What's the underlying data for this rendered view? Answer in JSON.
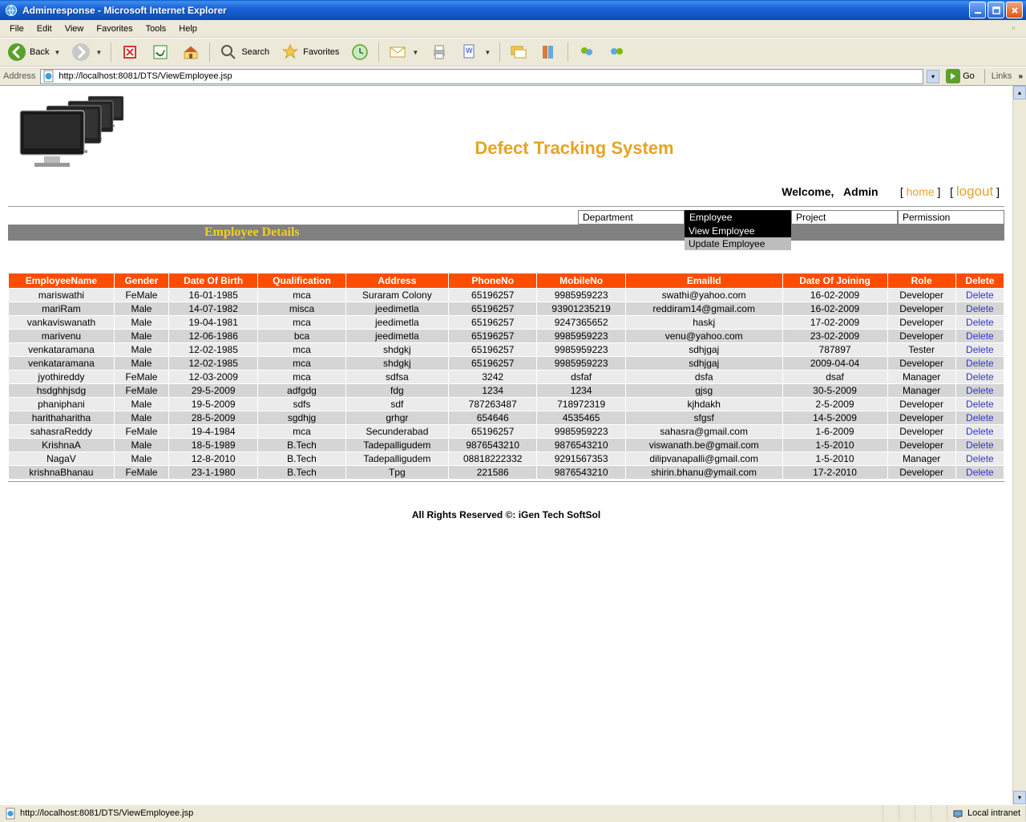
{
  "window": {
    "title": "Adminresponse - Microsoft Internet Explorer"
  },
  "menubar": [
    "File",
    "Edit",
    "View",
    "Favorites",
    "Tools",
    "Help"
  ],
  "toolbar": {
    "back": "Back",
    "search": "Search",
    "favorites": "Favorites"
  },
  "addressbar": {
    "label": "Address",
    "url": "http://localhost:8081/DTS/ViewEmployee.jsp",
    "go": "Go",
    "links": "Links"
  },
  "page": {
    "title": "Defect Tracking System",
    "welcome": "Welcome,",
    "user": "Admin",
    "home": "home",
    "logout": "logout",
    "section_title": "Employee Details",
    "nav": {
      "department": "Department",
      "employee": "Employee",
      "project": "Project",
      "permission": "Permission",
      "dd_view": "View Employee",
      "dd_update": "Update Employee"
    },
    "columns": [
      "EmployeeName",
      "Gender",
      "Date Of Birth",
      "Qualification",
      "Address",
      "PhoneNo",
      "MobileNo",
      "EmailId",
      "Date Of Joining",
      "Role",
      "Delete"
    ],
    "rows": [
      {
        "n": "mariswathi",
        "g": "FeMale",
        "dob": "16-01-1985",
        "q": "mca",
        "a": "Suraram Colony",
        "p": "65196257",
        "m": "9985959223",
        "e": "swathi@yahoo.com",
        "doj": "16-02-2009",
        "r": "Developer"
      },
      {
        "n": "mariRam",
        "g": "Male",
        "dob": "14-07-1982",
        "q": "misca",
        "a": "jeedimetla",
        "p": "65196257",
        "m": "93901235219",
        "e": "reddiram14@gmail.com",
        "doj": "16-02-2009",
        "r": "Developer"
      },
      {
        "n": "vankaviswanath",
        "g": "Male",
        "dob": "19-04-1981",
        "q": "mca",
        "a": "jeedimetla",
        "p": "65196257",
        "m": "9247365652",
        "e": "haskj",
        "doj": "17-02-2009",
        "r": "Developer"
      },
      {
        "n": "marivenu",
        "g": "Male",
        "dob": "12-06-1986",
        "q": "bca",
        "a": "jeedimetla",
        "p": "65196257",
        "m": "9985959223",
        "e": "venu@yahoo.com",
        "doj": "23-02-2009",
        "r": "Developer"
      },
      {
        "n": "venkataramana",
        "g": "Male",
        "dob": "12-02-1985",
        "q": "mca",
        "a": "shdgkj",
        "p": "65196257",
        "m": "9985959223",
        "e": "sdhjgaj",
        "doj": "787897",
        "r": "Tester"
      },
      {
        "n": "venkataramana",
        "g": "Male",
        "dob": "12-02-1985",
        "q": "mca",
        "a": "shdgkj",
        "p": "65196257",
        "m": "9985959223",
        "e": "sdhjgaj",
        "doj": "2009-04-04",
        "r": "Developer"
      },
      {
        "n": "jyothireddy",
        "g": "FeMale",
        "dob": "12-03-2009",
        "q": "mca",
        "a": "sdfsa",
        "p": "3242",
        "m": "dsfaf",
        "e": "dsfa",
        "doj": "dsaf",
        "r": "Manager"
      },
      {
        "n": "hsdghhjsdg",
        "g": "FeMale",
        "dob": "29-5-2009",
        "q": "adfgdg",
        "a": "fdg",
        "p": "1234",
        "m": "1234",
        "e": "gjsg",
        "doj": "30-5-2009",
        "r": "Manager"
      },
      {
        "n": "phaniphani",
        "g": "Male",
        "dob": "19-5-2009",
        "q": "sdfs",
        "a": "sdf",
        "p": "787263487",
        "m": "718972319",
        "e": "kjhdakh",
        "doj": "2-5-2009",
        "r": "Developer"
      },
      {
        "n": "harithaharitha",
        "g": "Male",
        "dob": "28-5-2009",
        "q": "sgdhjg",
        "a": "grhgr",
        "p": "654646",
        "m": "4535465",
        "e": "sfgsf",
        "doj": "14-5-2009",
        "r": "Developer"
      },
      {
        "n": "sahasraReddy",
        "g": "FeMale",
        "dob": "19-4-1984",
        "q": "mca",
        "a": "Secunderabad",
        "p": "65196257",
        "m": "9985959223",
        "e": "sahasra@gmail.com",
        "doj": "1-6-2009",
        "r": "Developer"
      },
      {
        "n": "KrishnaA",
        "g": "Male",
        "dob": "18-5-1989",
        "q": "B.Tech",
        "a": "Tadepalligudem",
        "p": "9876543210",
        "m": "9876543210",
        "e": "viswanath.be@gmail.com",
        "doj": "1-5-2010",
        "r": "Developer"
      },
      {
        "n": "NagaV",
        "g": "Male",
        "dob": "12-8-2010",
        "q": "B.Tech",
        "a": "Tadepalligudem",
        "p": "08818222332",
        "m": "9291567353",
        "e": "dilipvanapalli@gmail.com",
        "doj": "1-5-2010",
        "r": "Manager"
      },
      {
        "n": "krishnaBhanau",
        "g": "FeMale",
        "dob": "23-1-1980",
        "q": "B.Tech",
        "a": "Tpg",
        "p": "221586",
        "m": "9876543210",
        "e": "shirin.bhanu@ymail.com",
        "doj": "17-2-2010",
        "r": "Developer"
      }
    ],
    "delete_label": "Delete",
    "footer": "All Rights Reserved ©: iGen Tech SoftSol"
  },
  "statusbar": {
    "text": "http://localhost:8081/DTS/ViewEmployee.jsp",
    "zone": "Local intranet"
  }
}
